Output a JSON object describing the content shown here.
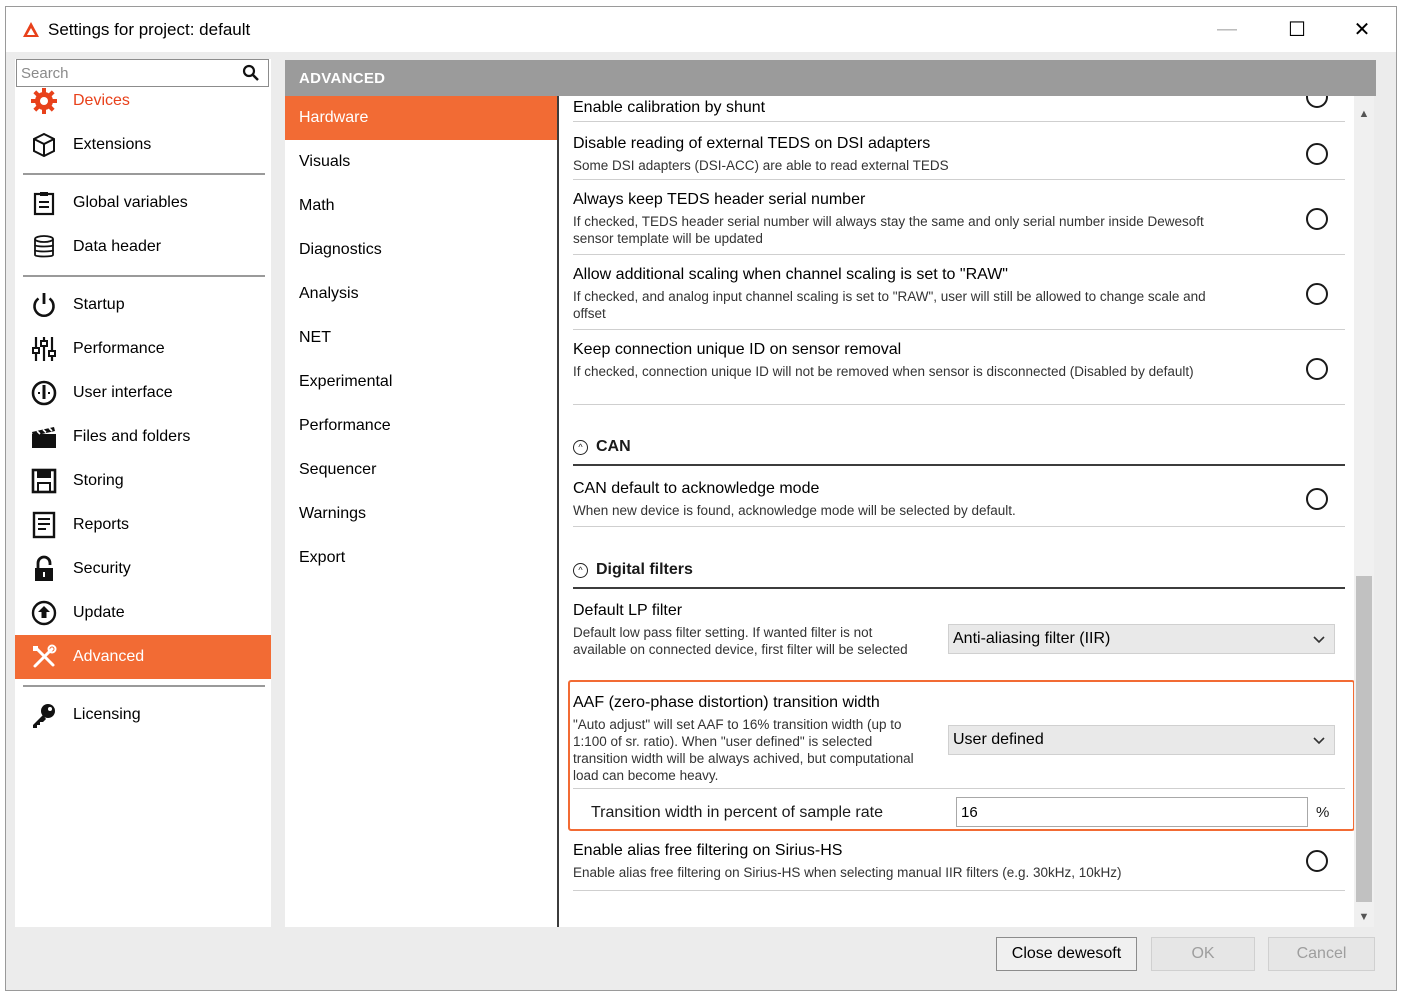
{
  "window": {
    "title": "Settings for project: default",
    "minimize_glyph": "—",
    "maximize_glyph": "☐",
    "close_glyph": "✕"
  },
  "search": {
    "placeholder": "Search",
    "value": ""
  },
  "nav": {
    "items": [
      {
        "id": "devices",
        "label": "Devices",
        "icon": "gear-icon",
        "color": "#e8411b"
      },
      {
        "id": "extensions",
        "label": "Extensions",
        "icon": "package-icon"
      },
      {
        "id": "global-variables",
        "label": "Global variables",
        "icon": "clipboard-icon"
      },
      {
        "id": "data-header",
        "label": "Data header",
        "icon": "database-icon"
      },
      {
        "id": "startup",
        "label": "Startup",
        "icon": "power-icon"
      },
      {
        "id": "performance",
        "label": "Performance",
        "icon": "sliders-icon"
      },
      {
        "id": "user-interface",
        "label": "User interface",
        "icon": "dial-icon"
      },
      {
        "id": "files-and-folders",
        "label": "Files and folders",
        "icon": "clapperboard-icon"
      },
      {
        "id": "storing",
        "label": "Storing",
        "icon": "floppy-disk-icon"
      },
      {
        "id": "reports",
        "label": "Reports",
        "icon": "report-icon"
      },
      {
        "id": "security",
        "label": "Security",
        "icon": "lock-icon"
      },
      {
        "id": "update",
        "label": "Update",
        "icon": "upload-icon"
      },
      {
        "id": "advanced",
        "label": "Advanced",
        "icon": "tools-icon",
        "selected": true
      },
      {
        "id": "licensing",
        "label": "Licensing",
        "icon": "key-icon"
      }
    ]
  },
  "advanced": {
    "header": "ADVANCED",
    "subitems": [
      {
        "label": "Hardware",
        "selected": true
      },
      {
        "label": "Visuals"
      },
      {
        "label": "Math"
      },
      {
        "label": "Diagnostics"
      },
      {
        "label": "Analysis"
      },
      {
        "label": "NET"
      },
      {
        "label": "Experimental"
      },
      {
        "label": "Performance"
      },
      {
        "label": "Sequencer"
      },
      {
        "label": "Warnings"
      },
      {
        "label": "Export"
      }
    ]
  },
  "settings": {
    "calibration": {
      "title": "Enable calibration by shunt",
      "checked": false
    },
    "dsi_teds": {
      "title": "Disable reading of external TEDS on DSI adapters",
      "desc": "Some DSI adapters (DSI-ACC) are able to read external TEDS",
      "checked": false
    },
    "keep_teds": {
      "title": "Always keep TEDS header serial number",
      "desc": "If checked, TEDS header serial number will always stay the same and only serial number inside Dewesoft sensor template will be updated",
      "checked": false
    },
    "raw_scaling": {
      "title": "Allow additional scaling when channel scaling is set to \"RAW\"",
      "desc": "If checked, and analog input channel scaling is set to \"RAW\", user will still be allowed to change scale and offset",
      "checked": false
    },
    "keep_uid": {
      "title": "Keep connection unique ID on sensor removal",
      "desc": "If checked, connection unique ID will not be removed when sensor is disconnected (Disabled by default)",
      "checked": false
    },
    "can_section": {
      "title": "CAN"
    },
    "can_ack": {
      "title": "CAN default to acknowledge mode",
      "desc": "When new device is found, acknowledge mode will be selected by default.",
      "checked": false
    },
    "df_section": {
      "title": "Digital filters"
    },
    "lp_filter": {
      "title": "Default LP filter",
      "desc": "Default low pass filter setting. If wanted filter is not available on connected device, first filter will be selected",
      "value": "Anti-aliasing filter (IIR)"
    },
    "aaf": {
      "title": "AAF (zero-phase distortion) transition width",
      "desc": "\"Auto adjust\" will set AAF to 16% transition width (up to 1:100 of sr. ratio). When \"user defined\" is selected transition width will be always achived, but computational load can become heavy.",
      "value": "User defined"
    },
    "transition": {
      "label": "Transition width in percent of sample rate",
      "value": "16",
      "unit": "%"
    },
    "alias_free": {
      "title": "Enable alias free filtering on Sirius-HS",
      "desc": "Enable alias free filtering on Sirius-HS when selecting manual IIR filters (e.g. 30kHz, 10kHz)",
      "checked": false
    }
  },
  "buttons": {
    "close": "Close dewesoft",
    "ok": "OK",
    "cancel": "Cancel"
  },
  "colors": {
    "accent": "#f26b34",
    "header_gray": "#9b9b9b",
    "devices_red": "#e8411b"
  }
}
